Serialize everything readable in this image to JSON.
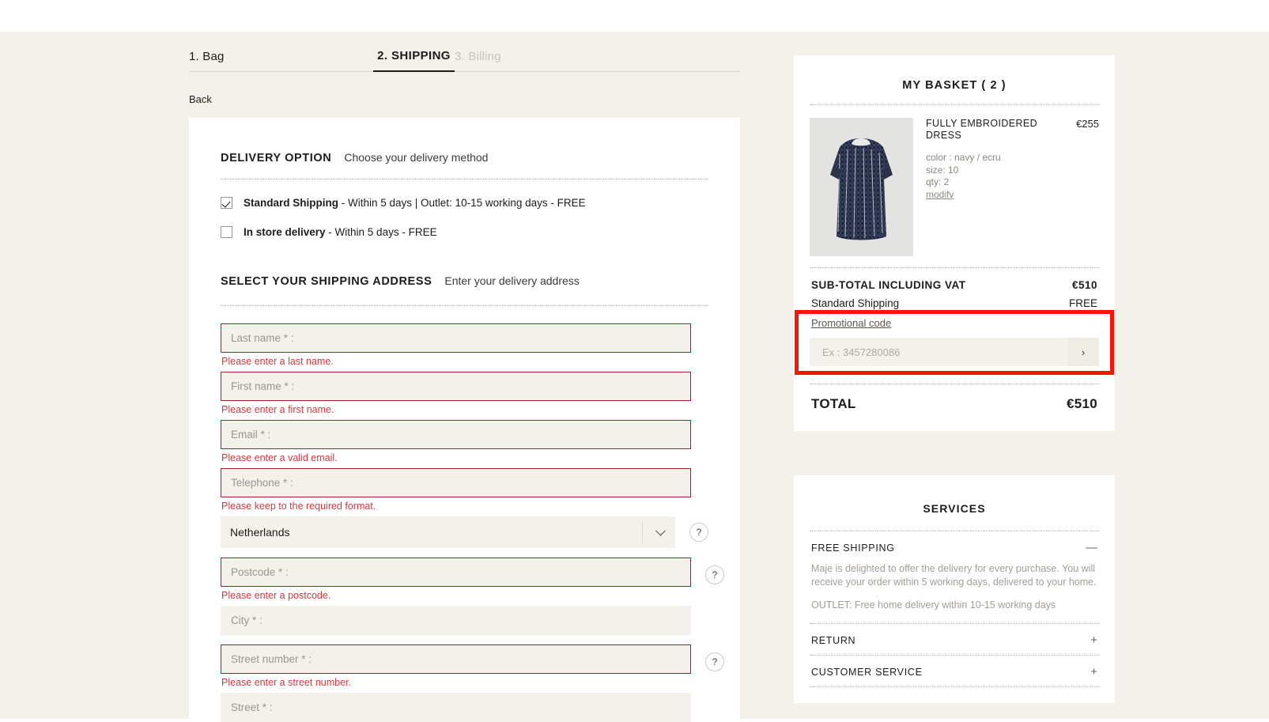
{
  "steps": [
    {
      "label": "1. Bag",
      "state": "done"
    },
    {
      "label": "2. SHIPPING",
      "state": "active"
    },
    {
      "label": "3. Billing",
      "state": "upcoming"
    }
  ],
  "back_label": "Back",
  "delivery": {
    "title": "DELIVERY OPTION",
    "subtitle": "Choose your delivery method",
    "options": [
      {
        "name": "Standard Shipping",
        "detail": " - Within 5 days  |  Outlet: 10-15 working days - FREE",
        "checked": true
      },
      {
        "name": "In store delivery",
        "detail": " - Within 5 days - FREE",
        "checked": false
      }
    ]
  },
  "address": {
    "title": "SELECT YOUR SHIPPING ADDRESS",
    "subtitle": "Enter your delivery address",
    "fields": [
      {
        "placeholder": "Last name * :",
        "error": "Please enter a last name."
      },
      {
        "placeholder": "First name * :",
        "error": "Please enter a first name."
      },
      {
        "placeholder": "Email * :",
        "error": "Please enter a valid email."
      },
      {
        "placeholder": "Telephone * :",
        "error": "Please keep to the required format."
      }
    ],
    "country": {
      "value": "Netherlands",
      "help": "?"
    },
    "postcode": {
      "placeholder": "Postcode * :",
      "error": "Please enter a postcode.",
      "help": "?"
    },
    "city": {
      "placeholder": "City * :"
    },
    "street_number": {
      "placeholder": "Street number * :",
      "error": "Please enter a street number.",
      "help": "?"
    },
    "street": {
      "placeholder": "Street * :"
    }
  },
  "basket": {
    "title": "MY BASKET ( 2 )",
    "item": {
      "name": "FULLY EMBROIDERED DRESS",
      "price": "€255",
      "color": "color : navy / ecru",
      "size": "size: 10",
      "qty": "qty: 2",
      "modify": "modify"
    },
    "subtotal_label": "SUB-TOTAL INCLUDING VAT",
    "subtotal_value": "€510",
    "shipping_label": "Standard Shipping",
    "shipping_value": "FREE",
    "promo_label": "Promotional code",
    "promo_placeholder": "Ex : 3457280086",
    "promo_submit": "›",
    "total_label": "TOTAL",
    "total_value": "€510"
  },
  "services": {
    "title": "SERVICES",
    "rows": [
      {
        "name": "FREE SHIPPING",
        "sign": "—",
        "expanded": true,
        "body1": "Maje is delighted to offer the delivery for every purchase. You will receive your order within 5 working days, delivered to your home.",
        "body2": "OUTLET: Free home delivery within 10-15 working days"
      },
      {
        "name": "RETURN",
        "sign": "+",
        "expanded": false
      },
      {
        "name": "CUSTOMER SERVICE",
        "sign": "+",
        "expanded": false
      }
    ]
  },
  "colors": {
    "page_bg": "#f4f1ea",
    "card_bg": "#ffffff",
    "error_red": "#d2383f",
    "error_border": "#a51d28",
    "highlight_red": "#fd1409"
  }
}
